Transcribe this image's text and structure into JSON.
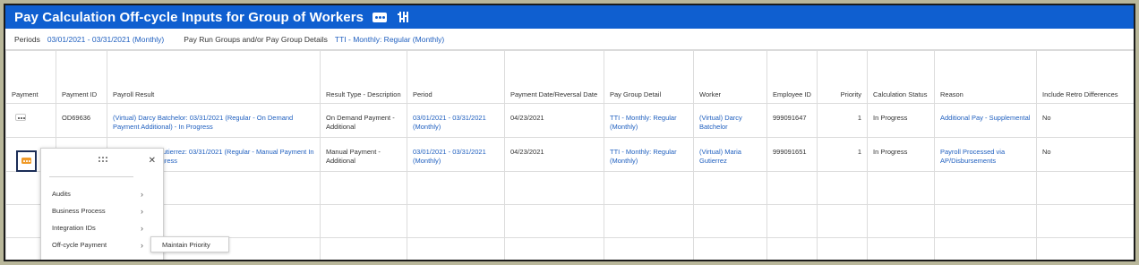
{
  "header": {
    "title": "Pay Calculation Off-cycle Inputs for Group of Workers"
  },
  "info": {
    "periods_label": "Periods",
    "periods_value": "03/01/2021 - 03/31/2021 (Monthly)",
    "pay_run_label": "Pay Run Groups and/or Pay Group Details",
    "pay_run_value": "TTI - Monthly: Regular (Monthly)"
  },
  "table": {
    "columns": [
      "Payment",
      "Payment ID",
      "Payroll Result",
      "Result Type - Description",
      "Period",
      "Payment Date/Reversal Date",
      "Pay Group Detail",
      "Worker",
      "Employee ID",
      "Priority",
      "Calculation Status",
      "Reason",
      "Include Retro Differences"
    ],
    "rows": [
      {
        "payment_id": "OD69636",
        "payroll_result": "(Virtual) Darcy Batchelor: 03/31/2021 (Regular - On Demand Payment Additional) - In Progress",
        "result_type": "On Demand Payment - Additional",
        "period": "03/01/2021 - 03/31/2021 (Monthly)",
        "payment_date": "04/23/2021",
        "pay_group_detail": "TTI - Monthly: Regular (Monthly)",
        "worker": "(Virtual) Darcy Batchelor",
        "employee_id": "999091647",
        "priority": "1",
        "calculation_status": "In Progress",
        "reason": "Additional Pay - Supplemental",
        "include_retro": "No"
      },
      {
        "payment_id": "",
        "payroll_result": "ia Gutierrez: 03/31/2021 (Regular - Manual Payment In Progress",
        "result_type": "Manual Payment - Additional",
        "period": "03/01/2021 - 03/31/2021 (Monthly)",
        "payment_date": "04/23/2021",
        "pay_group_detail": "TTI - Monthly: Regular (Monthly)",
        "worker": "(Virtual) Maria Gutierrez",
        "employee_id": "999091651",
        "priority": "1",
        "calculation_status": "In Progress",
        "reason": "Payroll Processed via AP/Disbursements",
        "include_retro": "No"
      }
    ]
  },
  "popup_menu": {
    "items": [
      "Audits",
      "Business Process",
      "Integration IDs",
      "Off-cycle Payment"
    ],
    "submenu_item": "Maintain Priority"
  },
  "icons": {
    "title_actions": "related-actions-icon",
    "title_settings": "configure-icon",
    "close": "close-icon",
    "chevron": "chevron-right-icon"
  },
  "colors": {
    "title_bar": "#0f5fd0",
    "link": "#1f5fbf",
    "related_actions_active": "#f09a28"
  }
}
